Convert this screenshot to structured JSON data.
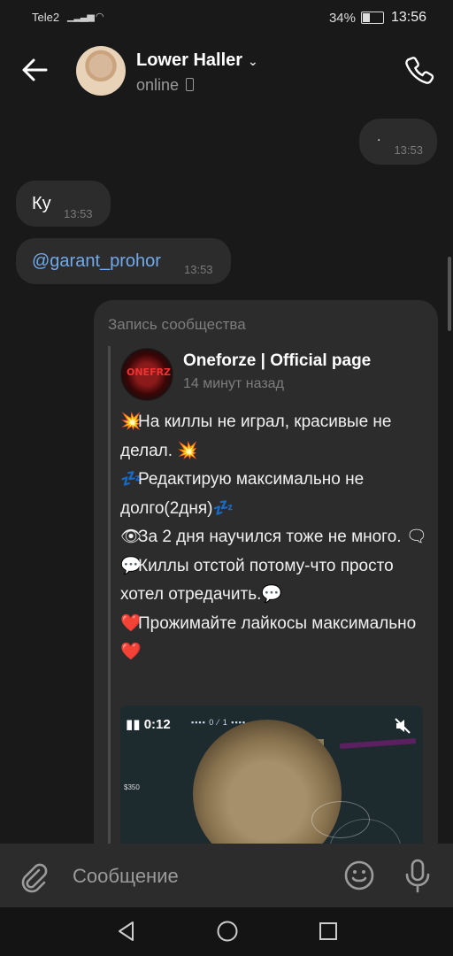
{
  "status": {
    "carrier": "Tele2",
    "battery": "34%",
    "time": "13:56"
  },
  "header": {
    "name": "Lower Haller",
    "status": "online"
  },
  "messages": [
    {
      "id": "out-1",
      "text": ".",
      "time": "13:53"
    },
    {
      "id": "in-1",
      "text": "Ку",
      "time": "13:53"
    },
    {
      "id": "in-2",
      "text": "@garant_prohor",
      "time": "13:53"
    }
  ],
  "post": {
    "label": "Запись сообщества",
    "group_name": "Oneforze | Official page",
    "posted": "14 минут назад",
    "lines": [
      {
        "emoji_start": "💥",
        "text": "На киллы не играл, красивые не делал.",
        "emoji_end": "💥"
      },
      {
        "emoji_start": "💤",
        "text": "Редактирую максимально не долго(2дня)",
        "emoji_end": "💤"
      },
      {
        "emoji_start": "👁",
        "text": "За 2 дня научился тоже не много.",
        "emoji_end": "🗨"
      },
      {
        "emoji_start": "💬",
        "text": "Киллы отстой потому-что просто хотел отредачить.",
        "emoji_end": "💬"
      },
      {
        "emoji_start": "❤️",
        "text": "Прожимайте лайкосы максимально",
        "emoji_end": "❤️"
      }
    ],
    "video": {
      "hud_time": "0:12"
    }
  },
  "composer": {
    "placeholder": "Сообщение"
  },
  "colors": {
    "background": "#19191a",
    "bubble": "#2c2c2d",
    "link": "#71aaeb",
    "secondary_text": "#7d7d7d"
  },
  "icons": {
    "back": "arrow-left-icon",
    "call": "phone-icon",
    "attach": "paperclip-icon",
    "emoji": "smile-icon",
    "voice": "microphone-icon"
  }
}
